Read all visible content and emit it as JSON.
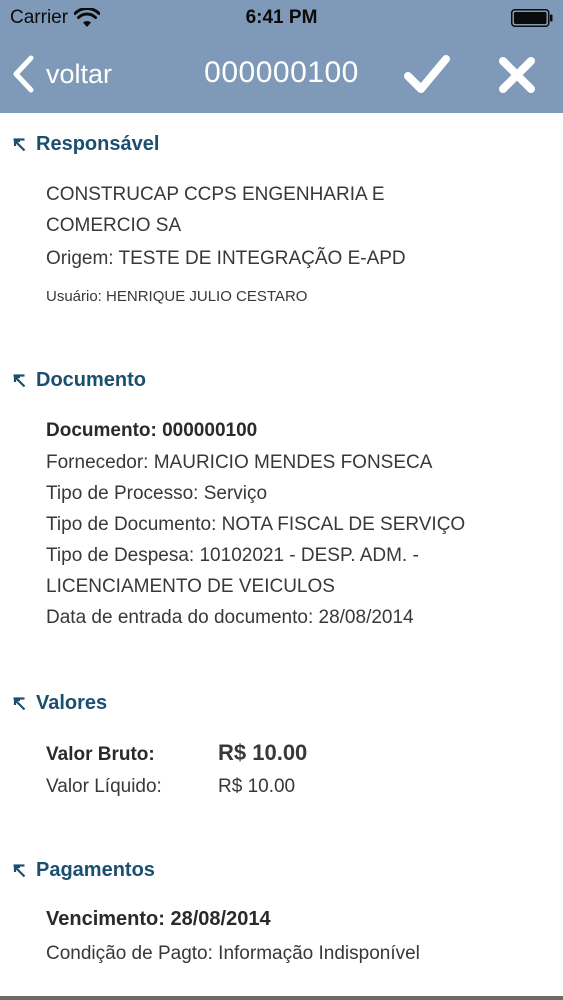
{
  "status_bar": {
    "carrier": "Carrier",
    "time": "6:41 PM"
  },
  "nav": {
    "back_label": "voltar",
    "title": "000000100"
  },
  "icons": {
    "back": "chevron-left-icon",
    "confirm": "checkmark-icon",
    "close": "close-icon",
    "collapse": "collapse-arrow-icon"
  },
  "colors": {
    "nav_background": "#7f9ab8",
    "section_header": "#1b4f6f",
    "body_text": "#383838"
  },
  "sections": {
    "responsavel": {
      "title": "Responsável",
      "company_line1": "CONSTRUCAP CCPS ENGENHARIA E",
      "company_line2": "COMERCIO SA",
      "origem": "Origem: TESTE DE INTEGRAÇÃO E-APD",
      "usuario": "Usuário: HENRIQUE JULIO CESTARO"
    },
    "documento": {
      "title": "Documento",
      "documento": "Documento: 000000100",
      "fornecedor": "Fornecedor: MAURICIO MENDES FONSECA",
      "tipo_processo": "Tipo de Processo: Serviço",
      "tipo_documento": "Tipo de Documento: NOTA FISCAL DE SERVIÇO",
      "tipo_despesa_line1": "Tipo de Despesa: 10102021 - DESP. ADM. -",
      "tipo_despesa_line2": "LICENCIAMENTO DE VEICULOS",
      "data_entrada": "Data de entrada do documento: 28/08/2014"
    },
    "valores": {
      "title": "Valores",
      "bruto_label": "Valor Bruto:",
      "bruto_value": "R$ 10.00",
      "liquido_label": "Valor Líquido:",
      "liquido_value": "R$ 10.00"
    },
    "pagamentos": {
      "title": "Pagamentos",
      "vencimento": "Vencimento: 28/08/2014",
      "condicao": "Condição de Pagto: Informação Indisponível"
    }
  }
}
